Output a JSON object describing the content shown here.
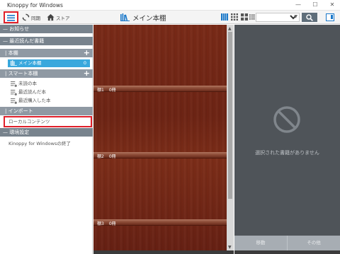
{
  "window": {
    "title": "Kinoppy for Windows",
    "controls": {
      "minimize": "—",
      "maximize": "☐",
      "close": "✕"
    }
  },
  "toolbar": {
    "sync_label": "同期",
    "store_label": "ストア",
    "shelf_title": "メイン本棚",
    "search_select_value": "",
    "icons": {
      "menu": "hamburger-menu-icon",
      "sync": "sync-icon",
      "store": "store-home-icon",
      "search": "search-icon"
    },
    "accent_color": "#1877c9"
  },
  "sidebar": {
    "news": "お知らせ",
    "recent": "最近読んだ書籍",
    "bookshelf": "本棚",
    "main_shelf": {
      "label": "メイン本棚",
      "count": "0"
    },
    "smart_shelf": "スマート本棚",
    "smart_items": [
      "未読の本",
      "最近読んだ本",
      "最近購入した本"
    ],
    "import": "インポート",
    "local_content": "ローカルコンテンツ",
    "settings": "環境設定",
    "quit": "Kinoppy for Windowsの終了",
    "highlight_color": "#e0202a",
    "selected_color": "#39a8dd"
  },
  "shelf": {
    "boards": [
      {
        "name": "棚1",
        "count": "0冊"
      },
      {
        "name": "棚2",
        "count": "0冊"
      },
      {
        "name": "棚3",
        "count": "0冊"
      }
    ]
  },
  "detail": {
    "empty_message": "選択された書籍がありません",
    "move_label": "移動",
    "other_label": "その他"
  }
}
